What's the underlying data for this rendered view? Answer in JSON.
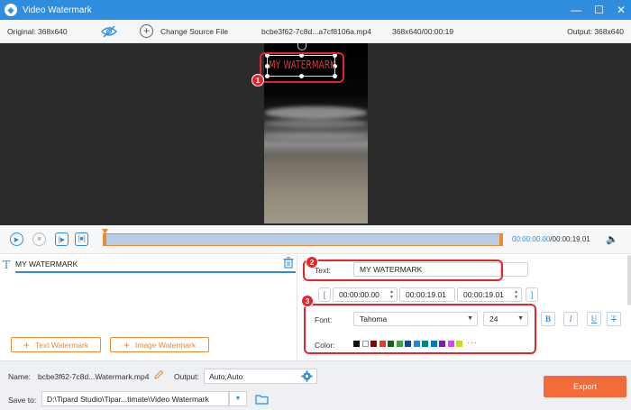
{
  "window": {
    "title": "Video Watermark",
    "controls": [
      "—",
      "☐",
      "✕"
    ]
  },
  "infobar": {
    "original": "Original: 368x640",
    "change_source": "Change Source File",
    "filename": "bcbe3f62-7c8d...a7cf8106a.mp4",
    "resolution_time": "368x640/00:00:19",
    "output": "Output: 368x640"
  },
  "preview": {
    "watermark_text": "MY WATERMARK"
  },
  "callouts": [
    "1",
    "2",
    "3"
  ],
  "playback": {
    "current": "00:00:00.00",
    "total": "/00:00:19.01",
    "progress": 0
  },
  "watermark_list": {
    "items": [
      {
        "label": "MY WATERMARK"
      }
    ]
  },
  "add_buttons": {
    "text": "Text Watermark",
    "image": "Image Watermark"
  },
  "editor": {
    "text_label": "Text:",
    "text_value": "MY WATERMARK",
    "start_time": "00:00:00.00",
    "duration": "00:00:19.01",
    "end_time": "00:00:19.01",
    "font_label": "Font:",
    "font_value": "Tahoma",
    "size_value": "24",
    "style_buttons": [
      "B",
      "I",
      "U",
      "T"
    ],
    "color_label": "Color:",
    "colors": [
      "#111111",
      "#ffffff",
      "#8b0000",
      "#e53935",
      "#1b5e20",
      "#43a047",
      "#0d47a1",
      "#1e88e5",
      "#00897b",
      "#0277bd",
      "#7b1fa2",
      "#e040fb",
      "#c6d82e"
    ],
    "more": "···"
  },
  "footer": {
    "name_label": "Name:",
    "name_value": "bcbe3f62-7c8d...Watermark.mp4",
    "output_label": "Output:",
    "output_value": "Auto;Auto",
    "save_label": "Save to:",
    "save_value": "D:\\Tipard Studio\\Tipar...timate\\Video Watermark",
    "export_label": "Export"
  }
}
